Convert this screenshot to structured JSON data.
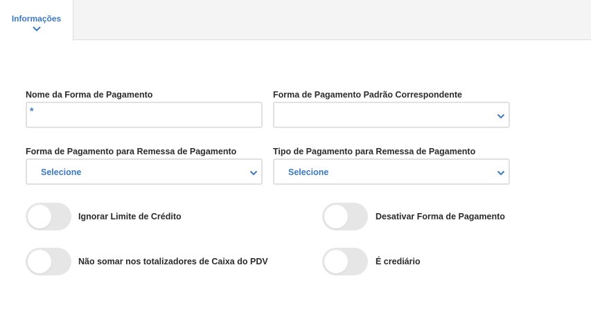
{
  "tabs": {
    "active_label": "Informações"
  },
  "form": {
    "payment_name": {
      "label": "Nome da Forma de Pagamento",
      "value": "*"
    },
    "default_payment": {
      "label": "Forma de Pagamento Padrão Correspondente",
      "value": ""
    },
    "remittance_payment_form": {
      "label": "Forma de Pagamento para Remessa de Pagamento",
      "value": "Selecione"
    },
    "remittance_payment_type": {
      "label": "Tipo de Pagamento para Remessa de Pagamento",
      "value": "Selecione"
    }
  },
  "toggles": {
    "ignore_credit_limit": {
      "label": "Ignorar Limite de Crédito",
      "on": false
    },
    "disable_payment": {
      "label": "Desativar Forma de Pagamento",
      "on": false
    },
    "no_sum_pdv": {
      "label": "Não somar nos totalizadores de Caixa do PDV",
      "on": false
    },
    "is_installment": {
      "label": "É crediário",
      "on": false
    }
  },
  "colors": {
    "accent": "#3b78c3",
    "toggle_off": "#e6e6e6",
    "border": "#e0e0e0"
  }
}
